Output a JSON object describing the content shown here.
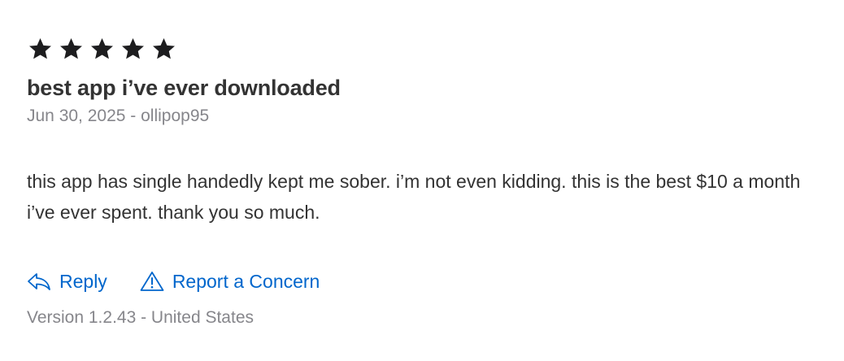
{
  "review": {
    "rating": 5,
    "rating_max": 5,
    "title": "best app i’ve ever downloaded",
    "date": "Jun 30, 2025",
    "separator": "-",
    "author": "ollipop95",
    "body": "this app has single handedly kept me sober. i’m not even kidding. this is the best $10 a month i’ve ever spent. thank you so much.",
    "version_label": "Version 1.2.43 - United States"
  },
  "actions": {
    "reply_label": "Reply",
    "reply_icon": "reply-arrow-icon",
    "report_label": "Report a Concern",
    "report_icon": "warning-triangle-icon"
  },
  "colors": {
    "star": "#1d1d1f",
    "link": "#0066cc",
    "meta": "#86868b",
    "text": "#333333"
  }
}
